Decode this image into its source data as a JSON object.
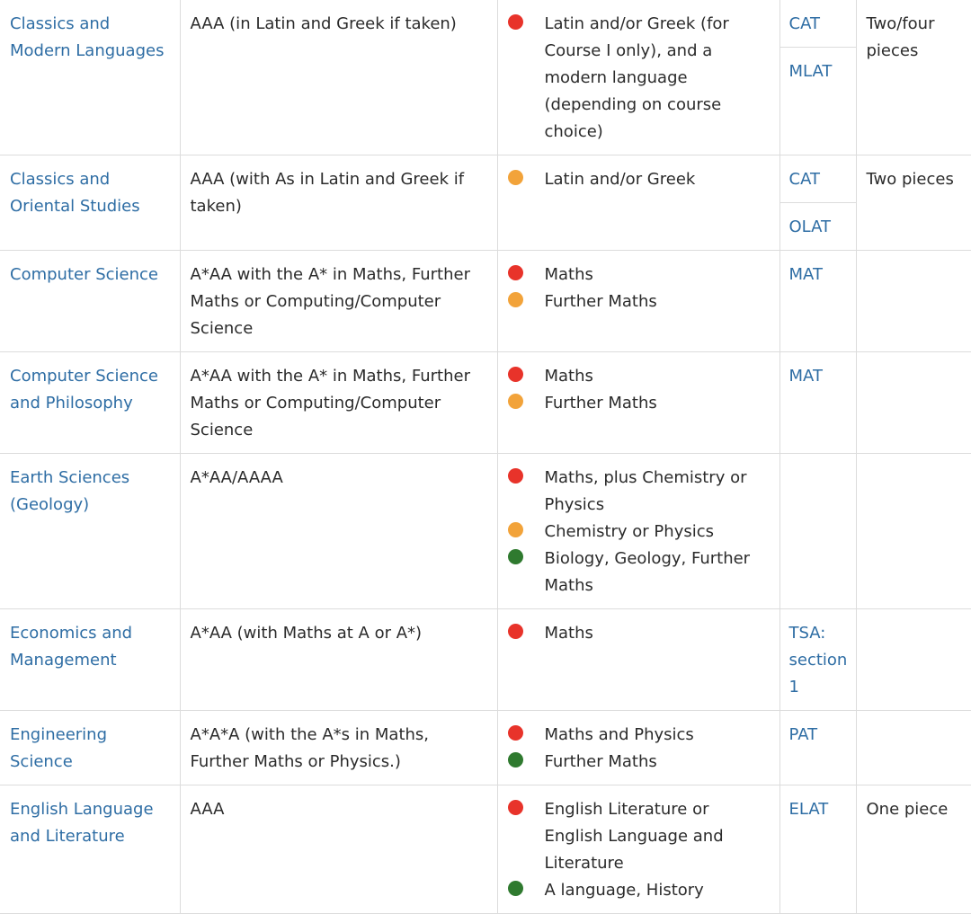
{
  "colors": {
    "link": "#2e6da4",
    "essential": "#e8332a",
    "recommended": "#f2a33a",
    "helpful": "#2f7a2f"
  },
  "rows": [
    {
      "course": "Classics and Modern Languages",
      "grades": "AAA (in Latin and Greek if taken)",
      "subjects": [
        {
          "level": "red",
          "text": "Latin and/or Greek (for Course I only), and a modern language (depending on course choice)"
        }
      ],
      "tests": [
        "CAT",
        "MLAT"
      ],
      "written_work": "Two/four pieces"
    },
    {
      "course": "Classics and Oriental Studies",
      "grades": "AAA (with As in Latin and Greek if taken)",
      "subjects": [
        {
          "level": "amber",
          "text": "Latin and/or Greek"
        }
      ],
      "tests": [
        "CAT",
        "OLAT"
      ],
      "written_work": "Two pieces"
    },
    {
      "course": "Computer Science",
      "grades": "A*AA with the A* in Maths, Further Maths or Computing/Computer Science",
      "subjects": [
        {
          "level": "red",
          "text": "Maths"
        },
        {
          "level": "amber",
          "text": "Further Maths"
        }
      ],
      "tests": [
        "MAT"
      ],
      "written_work": ""
    },
    {
      "course": "Computer Science and Philosophy",
      "grades": "A*AA with the A* in Maths, Further Maths or Computing/Computer Science",
      "subjects": [
        {
          "level": "red",
          "text": "Maths"
        },
        {
          "level": "amber",
          "text": "Further Maths"
        }
      ],
      "tests": [
        "MAT"
      ],
      "written_work": ""
    },
    {
      "course": "Earth Sciences (Geology)",
      "grades": "A*AA/AAAA",
      "subjects": [
        {
          "level": "red",
          "text": "Maths, plus Chemistry or Physics"
        },
        {
          "level": "amber",
          "text": "Chemistry or Physics"
        },
        {
          "level": "green",
          "text": "Biology, Geology, Further Maths"
        }
      ],
      "tests": [],
      "written_work": ""
    },
    {
      "course": "Economics and Management",
      "grades": "A*AA (with Maths at A or A*)",
      "subjects": [
        {
          "level": "red",
          "text": "Maths"
        }
      ],
      "tests": [
        "TSA: section 1"
      ],
      "written_work": ""
    },
    {
      "course": "Engineering Science",
      "grades": "A*A*A (with the A*s in Maths, Further Maths or Physics.)",
      "subjects": [
        {
          "level": "red",
          "text": "Maths and Physics"
        },
        {
          "level": "green",
          "text": "Further Maths"
        }
      ],
      "tests": [
        "PAT"
      ],
      "written_work": ""
    },
    {
      "course": "English Language and Literature",
      "grades": "AAA",
      "subjects": [
        {
          "level": "red",
          "text": "English Literature or English Language and Literature"
        },
        {
          "level": "green",
          "text": "A language, History"
        }
      ],
      "tests": [
        "ELAT"
      ],
      "written_work": "One piece"
    }
  ]
}
